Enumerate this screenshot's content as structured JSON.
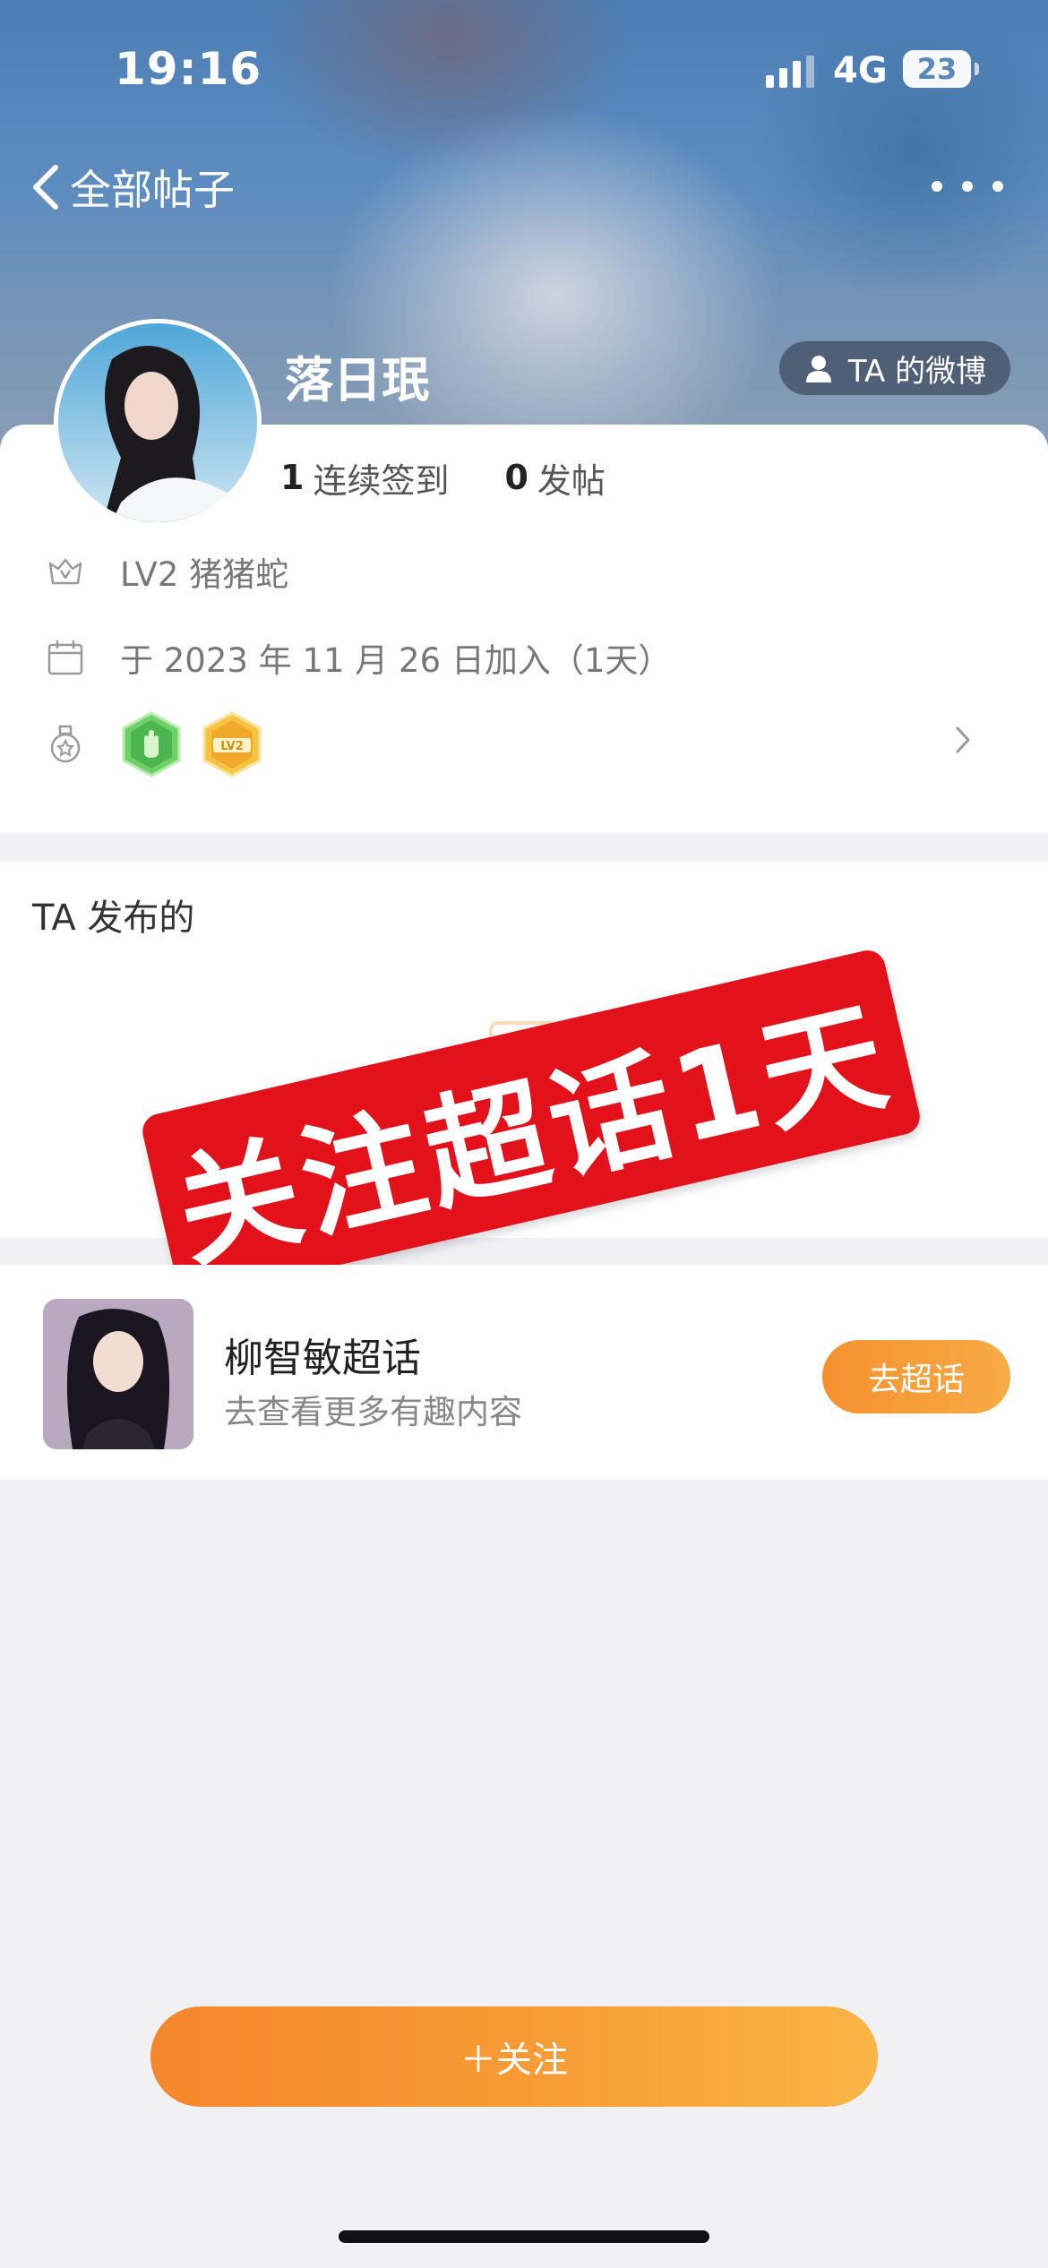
{
  "status_bar": {
    "time": "19:16",
    "network": "4G",
    "battery": "23"
  },
  "nav": {
    "back_label": "全部帖子"
  },
  "profile": {
    "username": "落日珉",
    "weibo_button": "TA 的微博",
    "stats": [
      {
        "num": "1",
        "label": "连续签到"
      },
      {
        "num": "0",
        "label": "发帖"
      }
    ],
    "level": "LV2 猪猪蛇",
    "joined": "于 2023 年 11 月 26 日加入（1天）",
    "badge_icons": [
      "hand-badge-icon",
      "lv2-badge-icon"
    ]
  },
  "posted": {
    "title": "TA 发布的"
  },
  "overlay": {
    "stamp_text": "关注超话1天"
  },
  "topic": {
    "name": "柳智敏超话",
    "description": "去查看更多有趣内容",
    "button": "去超话"
  },
  "follow_button": "＋关注",
  "colors": {
    "accent_orange": "#f79a35",
    "stamp_red": "#e3121a"
  }
}
